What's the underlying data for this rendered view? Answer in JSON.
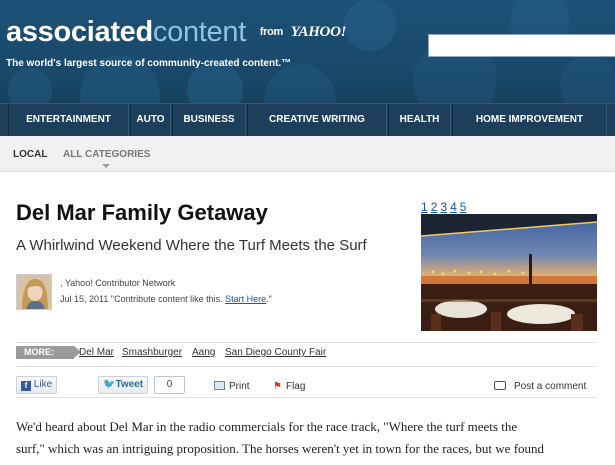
{
  "header": {
    "logo_part1": "associated",
    "logo_part2": "content",
    "logo_from": "from",
    "logo_yahoo": "YAHOO!",
    "tagline": "The world's largest source of community-created content.™",
    "search_value": ""
  },
  "nav": {
    "items": [
      "ENTERTAINMENT",
      "AUTO",
      "BUSINESS",
      "CREATIVE WRITING",
      "HEALTH",
      "HOME IMPROVEMENT"
    ]
  },
  "subnav": {
    "local": "LOCAL",
    "all_categories": "ALL CATEGORIES"
  },
  "article": {
    "title": "Del Mar Family Getaway",
    "subtitle": "A Whirlwind Weekend Where the Turf Meets the Surf",
    "byline_network": ", Yahoo! Contributor Network",
    "byline_date": "Jul 15, 2011 \"Contribute content like this.",
    "byline_link": "Start Here",
    "byline_end": ".\"",
    "pages": [
      "1",
      "2",
      "3",
      "4",
      "5"
    ],
    "more_label": "MORE:",
    "tags": [
      "Del Mar",
      "Smashburger",
      "Aang",
      "San Diego County Fair"
    ],
    "body_line1": "We'd heard about Del Mar in the radio commercials for the race track, \"Where the turf meets the",
    "body_line2": "surf,\" which was an intriguing proposition. The horses weren't yet in town for the races, but we found"
  },
  "social": {
    "like_label": "Like",
    "tweet_label": "Tweet",
    "tweet_count": "0",
    "print_label": "Print",
    "flag_label": "Flag",
    "comment_label": "Post a comment"
  },
  "colors": {
    "header_bg": "#1b4b6f",
    "nav_bg": "#1d3f5b",
    "link": "#1a55a6",
    "logo_accent": "#8fc3e6"
  }
}
